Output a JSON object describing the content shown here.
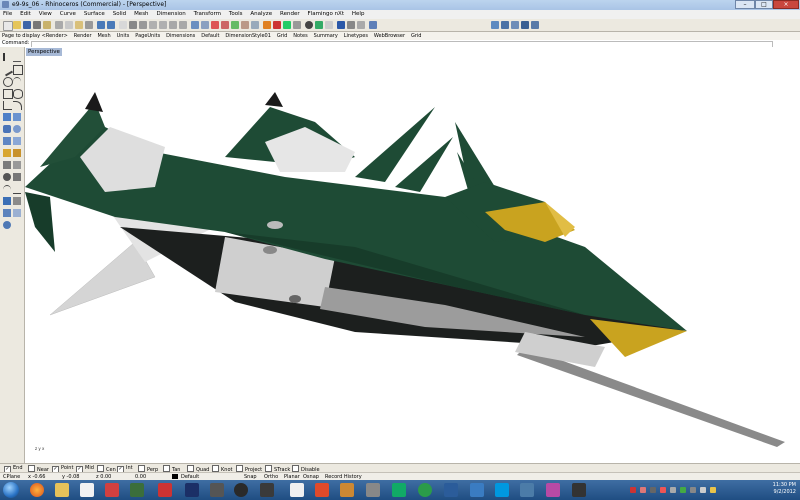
{
  "window": {
    "title": "e9-9s_06 - Rhinoceros (Commercial) - [Perspective]",
    "min": "–",
    "max": "□",
    "close": "×"
  },
  "menu": [
    "File",
    "Edit",
    "View",
    "Curve",
    "Surface",
    "Solid",
    "Mesh",
    "Dimension",
    "Transform",
    "Tools",
    "Analyze",
    "Render",
    "Flamingo nXt",
    "Help"
  ],
  "tabs": [
    "Page to display <Render>",
    "Render",
    "Mesh",
    "Units",
    "PageUnits",
    "Dimensions",
    "Default",
    "DimensionStyle01",
    "Grid",
    "Notes",
    "Summary",
    "Linetypes",
    "WebBrowser",
    "Grid"
  ],
  "command": {
    "label": "Command:",
    "value": ""
  },
  "viewport": {
    "label": "Perspective",
    "axis_label": "z  y  x"
  },
  "osnap": [
    {
      "label": "End",
      "checked": true
    },
    {
      "label": "Near",
      "checked": false
    },
    {
      "label": "Point",
      "checked": true
    },
    {
      "label": "Mid",
      "checked": true
    },
    {
      "label": "Cen",
      "checked": false
    },
    {
      "label": "Int",
      "checked": true
    },
    {
      "label": "Perp",
      "checked": false
    },
    {
      "label": "Tan",
      "checked": false
    },
    {
      "label": "Quad",
      "checked": false
    },
    {
      "label": "Knot",
      "checked": false
    },
    {
      "label": "Project",
      "checked": false
    },
    {
      "label": "STrack",
      "checked": false
    },
    {
      "label": "Disable",
      "checked": false
    }
  ],
  "status": {
    "cplane": "CPlane",
    "x": "x -0.66",
    "y": "y -0.08",
    "z": "z 0.00",
    "v1": "0.00",
    "layer": "Default",
    "snap": "Snap",
    "ortho": "Ortho",
    "planar": "Planar",
    "osnap": "Osnap",
    "record": "Record History"
  },
  "clock": {
    "time": "11:30 PM",
    "date": "9/2/2012"
  },
  "colors": {
    "accent": "#2a5b8a",
    "model_green": "#1f4a33",
    "model_gold": "#c8a020",
    "model_grey": "#cfcfcf"
  }
}
